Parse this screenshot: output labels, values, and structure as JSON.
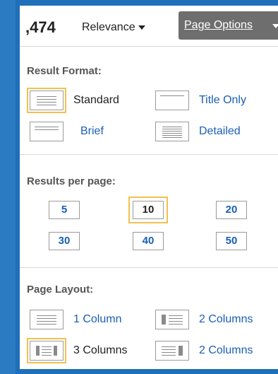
{
  "topbar": {
    "count": ",474",
    "sort_label": "Relevance",
    "page_options_label": "Page Options"
  },
  "result_format": {
    "title": "Result Format:",
    "options": [
      {
        "label": "Standard",
        "icon": "standard-format-icon",
        "selected": true
      },
      {
        "label": "Title Only",
        "icon": "title-only-format-icon",
        "selected": false
      },
      {
        "label": "Brief",
        "icon": "brief-format-icon",
        "selected": false
      },
      {
        "label": "Detailed",
        "icon": "detailed-format-icon",
        "selected": false
      }
    ]
  },
  "results_per_page": {
    "title": "Results per page:",
    "options": [
      "5",
      "10",
      "20",
      "30",
      "40",
      "50"
    ],
    "selected": "10"
  },
  "page_layout": {
    "title": "Page Layout:",
    "options": [
      {
        "label": "1 Column",
        "icon": "one-column-layout-icon",
        "selected": false
      },
      {
        "label": "2 Columns",
        "icon": "two-columns-left-layout-icon",
        "selected": false
      },
      {
        "label": "3 Columns",
        "icon": "three-columns-layout-icon",
        "selected": true
      },
      {
        "label": "2 Columns",
        "icon": "two-columns-right-layout-icon",
        "selected": false
      }
    ]
  },
  "colors": {
    "accent_blue": "#1a5fb4",
    "frame_blue": "#1f6fb9",
    "selected_outline": "#f2c14e",
    "button_gray": "#6e6e6e"
  }
}
